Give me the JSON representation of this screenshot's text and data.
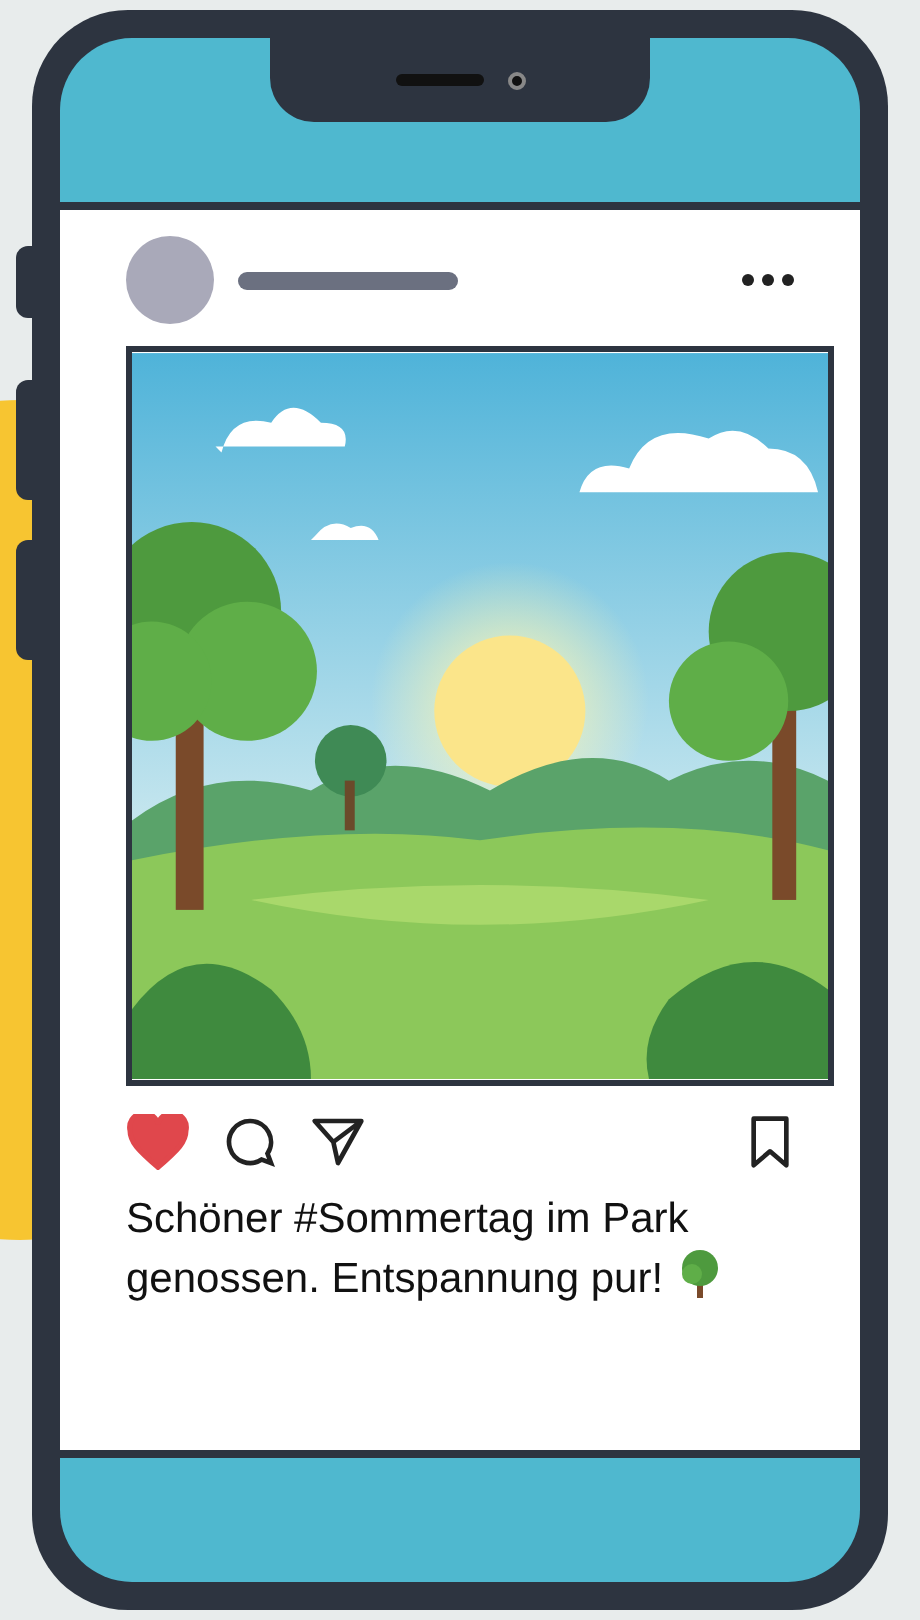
{
  "post": {
    "liked": true,
    "caption": "Schöner #Sommertag im Park genossen. Entspannung pur!"
  }
}
